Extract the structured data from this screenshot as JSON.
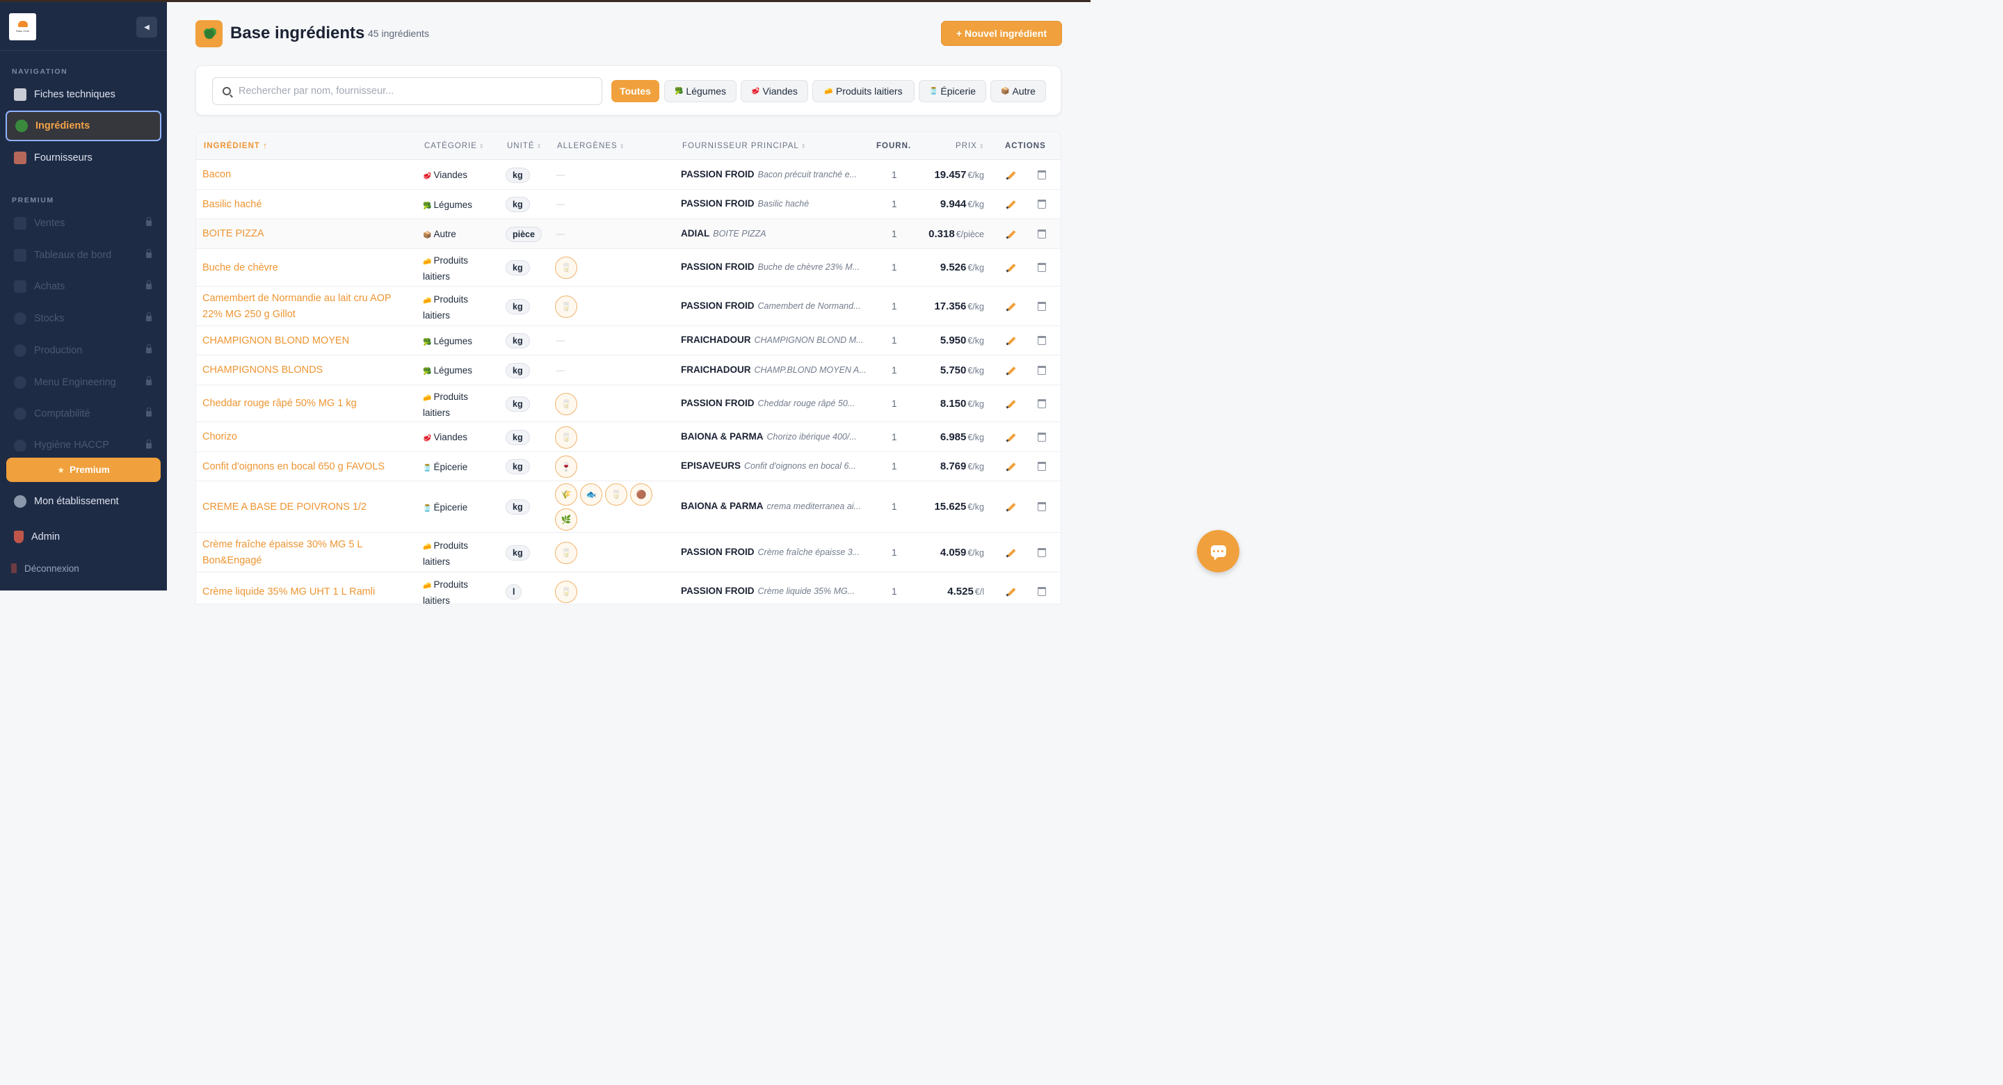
{
  "sidebar": {
    "logo_text": "Ratio Chef",
    "collapse_icon": "◀",
    "navigation_title": "NAVIGATION",
    "premium_title": "PREMIUM",
    "nav": [
      {
        "label": "Fiches techniques",
        "icon": "clipboard-icon"
      },
      {
        "label": "Ingrédients",
        "icon": "broccoli-icon"
      },
      {
        "label": "Fournisseurs",
        "icon": "building-icon"
      }
    ],
    "premium_items": [
      {
        "label": "Ventes",
        "icon": "chart-icon"
      },
      {
        "label": "Tableaux de bord",
        "icon": "chart-up-icon"
      },
      {
        "label": "Achats",
        "icon": "cart-icon"
      },
      {
        "label": "Stocks",
        "icon": "box-icon"
      },
      {
        "label": "Production",
        "icon": "pot-icon"
      },
      {
        "label": "Menu Engineering",
        "icon": "target-icon"
      },
      {
        "label": "Comptabilité",
        "icon": "money-bag-icon"
      },
      {
        "label": "Hygiène HACCP",
        "icon": "soap-icon"
      }
    ],
    "premium_button": "Premium",
    "bottom": [
      {
        "label": "Mon établissement",
        "icon": "chef-icon"
      },
      {
        "label": "Admin",
        "icon": "shield-icon"
      },
      {
        "label": "Déconnexion",
        "icon": "door-icon"
      }
    ]
  },
  "header": {
    "title": "Base ingrédients",
    "count": "45 ingrédients",
    "new_button": "+ Nouvel ingrédient"
  },
  "filters": {
    "search_placeholder": "Rechercher par nom, fournisseur...",
    "chips": [
      {
        "label": "Toutes",
        "icon": ""
      },
      {
        "label": "Légumes",
        "icon": "🥦"
      },
      {
        "label": "Viandes",
        "icon": "🥩"
      },
      {
        "label": "Produits laitiers",
        "icon": "🧀"
      },
      {
        "label": "Épicerie",
        "icon": "🫙"
      },
      {
        "label": "Autre",
        "icon": "📦"
      }
    ]
  },
  "table": {
    "headers": {
      "ingredient": "INGRÉDIENT",
      "sort_arrow": "↑",
      "categorie": "CATÉGORIE",
      "unite": "UNITÉ",
      "allergenes": "ALLERGÈNES",
      "fournisseur": "FOURNISSEUR PRINCIPAL",
      "fourn": "FOURN.",
      "prix": "PRIX",
      "actions": "ACTIONS"
    },
    "empty_allergen": "—",
    "rows": [
      {
        "name": "Bacon",
        "cat_icon": "🥩",
        "cat": "Viandes",
        "unit": "kg",
        "allergens": [],
        "supplier": "PASSION FROID",
        "desc": "Bacon précuit tranché e...",
        "fourn": "1",
        "price": "19.457",
        "per": "€/kg"
      },
      {
        "name": "Basilic haché",
        "cat_icon": "🥦",
        "cat": "Légumes",
        "unit": "kg",
        "allergens": [],
        "supplier": "PASSION FROID",
        "desc": "Basilic haché",
        "fourn": "1",
        "price": "9.944",
        "per": "€/kg"
      },
      {
        "name": "BOITE PIZZA",
        "cat_icon": "📦",
        "cat": "Autre",
        "unit": "pièce",
        "allergens": [],
        "supplier": "ADIAL",
        "desc": "BOITE PIZZA",
        "fourn": "1",
        "price": "0.318",
        "per": "€/pièce"
      },
      {
        "name": "Buche de chèvre",
        "cat_icon": "🧀",
        "cat": "Produits laitiers",
        "unit": "kg",
        "allergens": [
          "🥛"
        ],
        "supplier": "PASSION FROID",
        "desc": "Buche de chèvre 23% M...",
        "fourn": "1",
        "price": "9.526",
        "per": "€/kg"
      },
      {
        "name": "Camembert de Normandie au lait cru AOP 22% MG 250 g Gillot",
        "cat_icon": "🧀",
        "cat": "Produits laitiers",
        "unit": "kg",
        "allergens": [
          "🥛"
        ],
        "supplier": "PASSION FROID",
        "desc": "Camembert de Normand...",
        "fourn": "1",
        "price": "17.356",
        "per": "€/kg"
      },
      {
        "name": "CHAMPIGNON BLOND MOYEN",
        "cat_icon": "🥦",
        "cat": "Légumes",
        "unit": "kg",
        "allergens": [],
        "supplier": "FRAICHADOUR",
        "desc": "CHAMPIGNON BLOND M...",
        "fourn": "1",
        "price": "5.950",
        "per": "€/kg"
      },
      {
        "name": "CHAMPIGNONS BLONDS",
        "cat_icon": "🥦",
        "cat": "Légumes",
        "unit": "kg",
        "allergens": [],
        "supplier": "FRAICHADOUR",
        "desc": "CHAMP.BLOND MOYEN A...",
        "fourn": "1",
        "price": "5.750",
        "per": "€/kg"
      },
      {
        "name": "Cheddar rouge râpé 50% MG 1 kg",
        "cat_icon": "🧀",
        "cat": "Produits laitiers",
        "unit": "kg",
        "allergens": [
          "🥛"
        ],
        "supplier": "PASSION FROID",
        "desc": "Cheddar rouge râpé 50...",
        "fourn": "1",
        "price": "8.150",
        "per": "€/kg"
      },
      {
        "name": "Chorizo",
        "cat_icon": "🥩",
        "cat": "Viandes",
        "unit": "kg",
        "allergens": [
          "🥛"
        ],
        "supplier": "BAIONA & PARMA",
        "desc": "Chorizo ibérique 400/...",
        "fourn": "1",
        "price": "6.985",
        "per": "€/kg"
      },
      {
        "name": "Confit d'oignons en bocal 650 g FAVOLS",
        "cat_icon": "🫙",
        "cat": "Épicerie",
        "unit": "kg",
        "allergens": [
          "🍷"
        ],
        "supplier": "EPISAVEURS",
        "desc": "Confit d'oignons en bocal 6...",
        "fourn": "1",
        "price": "8.769",
        "per": "€/kg"
      },
      {
        "name": "CREME A BASE DE POIVRONS 1/2",
        "cat_icon": "🫙",
        "cat": "Épicerie",
        "unit": "kg",
        "allergens": [
          "🌾",
          "🐟",
          "🥛",
          "🟤",
          "🌿"
        ],
        "supplier": "BAIONA & PARMA",
        "desc": "crema mediterranea ai...",
        "fourn": "1",
        "price": "15.625",
        "per": "€/kg"
      },
      {
        "name": "Crème fraîche épaisse 30% MG 5 L Bon&Engagé",
        "cat_icon": "🧀",
        "cat": "Produits laitiers",
        "unit": "kg",
        "allergens": [
          "🥛"
        ],
        "supplier": "PASSION FROID",
        "desc": "Crème fraîche épaisse 3...",
        "fourn": "1",
        "price": "4.059",
        "per": "€/kg"
      },
      {
        "name": "Crème liquide 35% MG UHT 1 L Ramli",
        "cat_icon": "🧀",
        "cat": "Produits laitiers",
        "unit": "l",
        "allergens": [
          "🥛"
        ],
        "supplier": "PASSION FROID",
        "desc": "Crème liquide 35% MG...",
        "fourn": "1",
        "price": "4.525",
        "per": "€/l"
      }
    ]
  },
  "colors": {
    "accent": "#f0a03c",
    "sidebar": "#1e2b45",
    "link": "#ee9533"
  }
}
